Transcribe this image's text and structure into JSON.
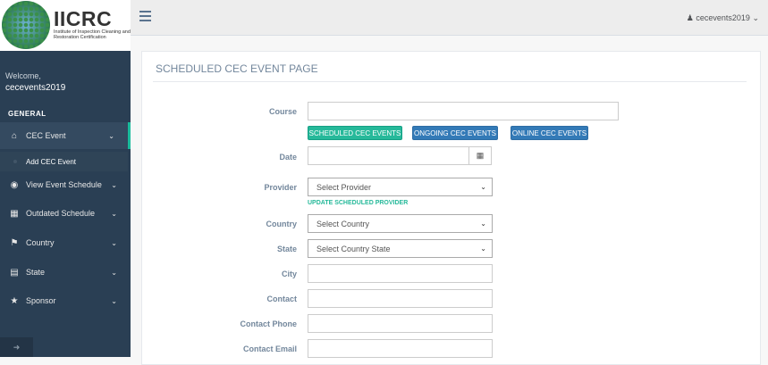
{
  "brand": {
    "name": "IICRC",
    "subtitle": "Institute of Inspection Cleaning and Restoration Certification"
  },
  "sidebar": {
    "welcome": "Welcome,",
    "username": "cecevents2019",
    "section": "GENERAL",
    "items": [
      {
        "label": "CEC Event",
        "icon": "home-icon",
        "glyph": "⌂"
      },
      {
        "label": "View Event Schedule",
        "icon": "eye-icon",
        "glyph": "◉"
      },
      {
        "label": "Outdated Schedule",
        "icon": "calendar-icon",
        "glyph": "▦"
      },
      {
        "label": "Country",
        "icon": "flag-icon",
        "glyph": "⚑"
      },
      {
        "label": "State",
        "icon": "table-icon",
        "glyph": "▤"
      },
      {
        "label": "Sponsor",
        "icon": "star-icon",
        "glyph": "★"
      }
    ],
    "sub_item": "Add CEC Event"
  },
  "topbar": {
    "user": "cecevents2019"
  },
  "page": {
    "title": "SCHEDULED CEC EVENT PAGE"
  },
  "form": {
    "course_label": "Course",
    "date_label": "Date",
    "provider_label": "Provider",
    "provider_value": "Select Provider",
    "update_provider": "UPDATE SCHEDULED PROVIDER",
    "country_label": "Country",
    "country_value": "Select Country",
    "state_label": "State",
    "state_value": "Select Country State",
    "city_label": "City",
    "contact_label": "Contact",
    "contact_phone_label": "Contact Phone",
    "contact_email_label": "Contact Email",
    "buttons": {
      "scheduled": "SCHEDULED CEC EVENTS",
      "ongoing": "ONGOING CEC EVENTS",
      "online": "ONLINE CEC EVENTS"
    }
  },
  "colors": {
    "sidebar": "#2a3f54",
    "accent_green": "#26b99a",
    "accent_blue": "#337ab7"
  }
}
